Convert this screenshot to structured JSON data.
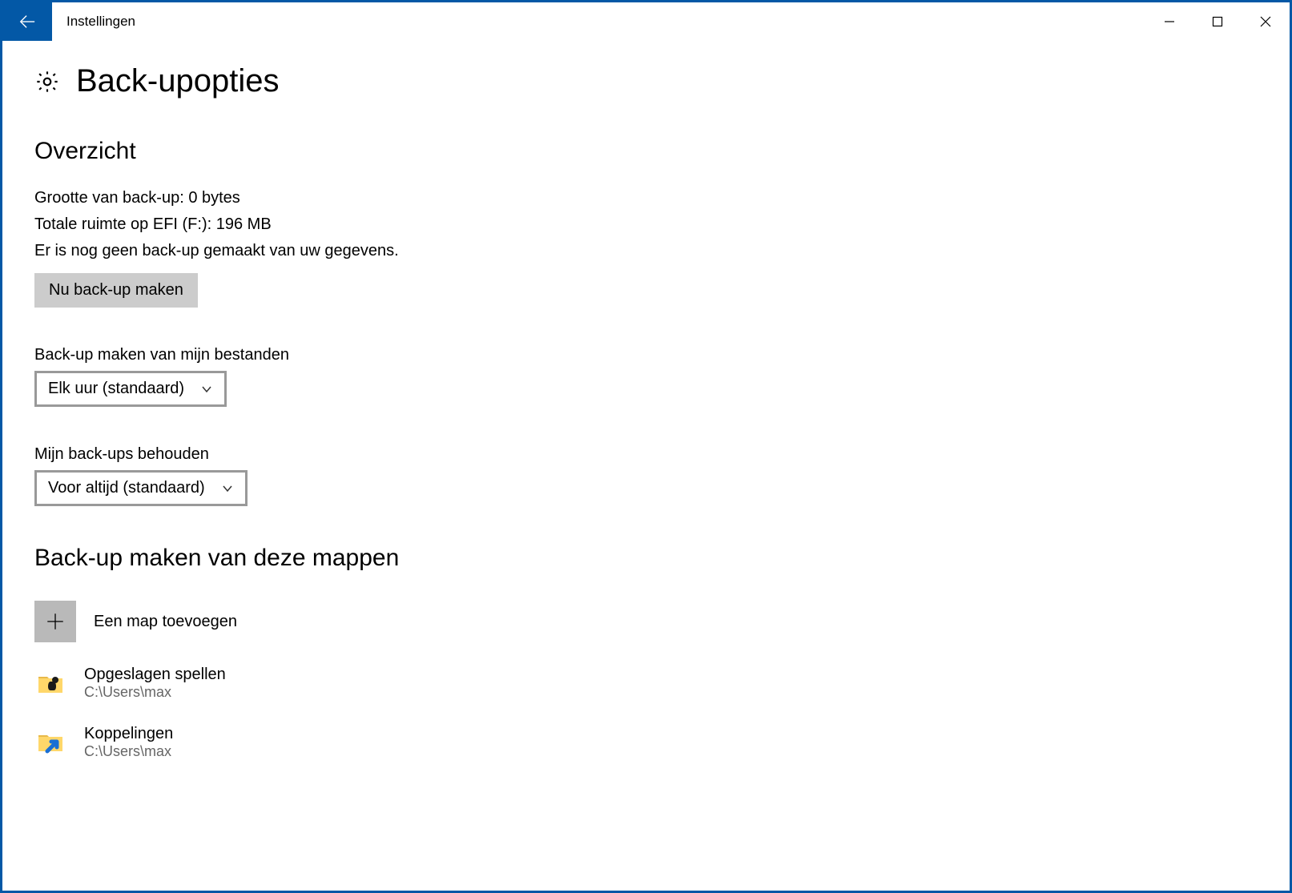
{
  "window": {
    "title": "Instellingen"
  },
  "page": {
    "title": "Back-upopties"
  },
  "overview": {
    "heading": "Overzicht",
    "size_line": "Grootte van back-up: 0 bytes",
    "space_line": "Totale ruimte op EFI (F:): 196 MB",
    "status_line": "Er is nog geen back-up gemaakt van uw gegevens.",
    "backup_now_label": "Nu back-up maken"
  },
  "frequency": {
    "label": "Back-up maken van mijn bestanden",
    "selected": "Elk uur (standaard)"
  },
  "retention": {
    "label": "Mijn back-ups behouden",
    "selected": "Voor altijd (standaard)"
  },
  "folders": {
    "heading": "Back-up maken van deze mappen",
    "add_label": "Een map toevoegen",
    "items": [
      {
        "name": "Opgeslagen spellen",
        "path": "C:\\Users\\max"
      },
      {
        "name": "Koppelingen",
        "path": "C:\\Users\\max"
      }
    ]
  }
}
